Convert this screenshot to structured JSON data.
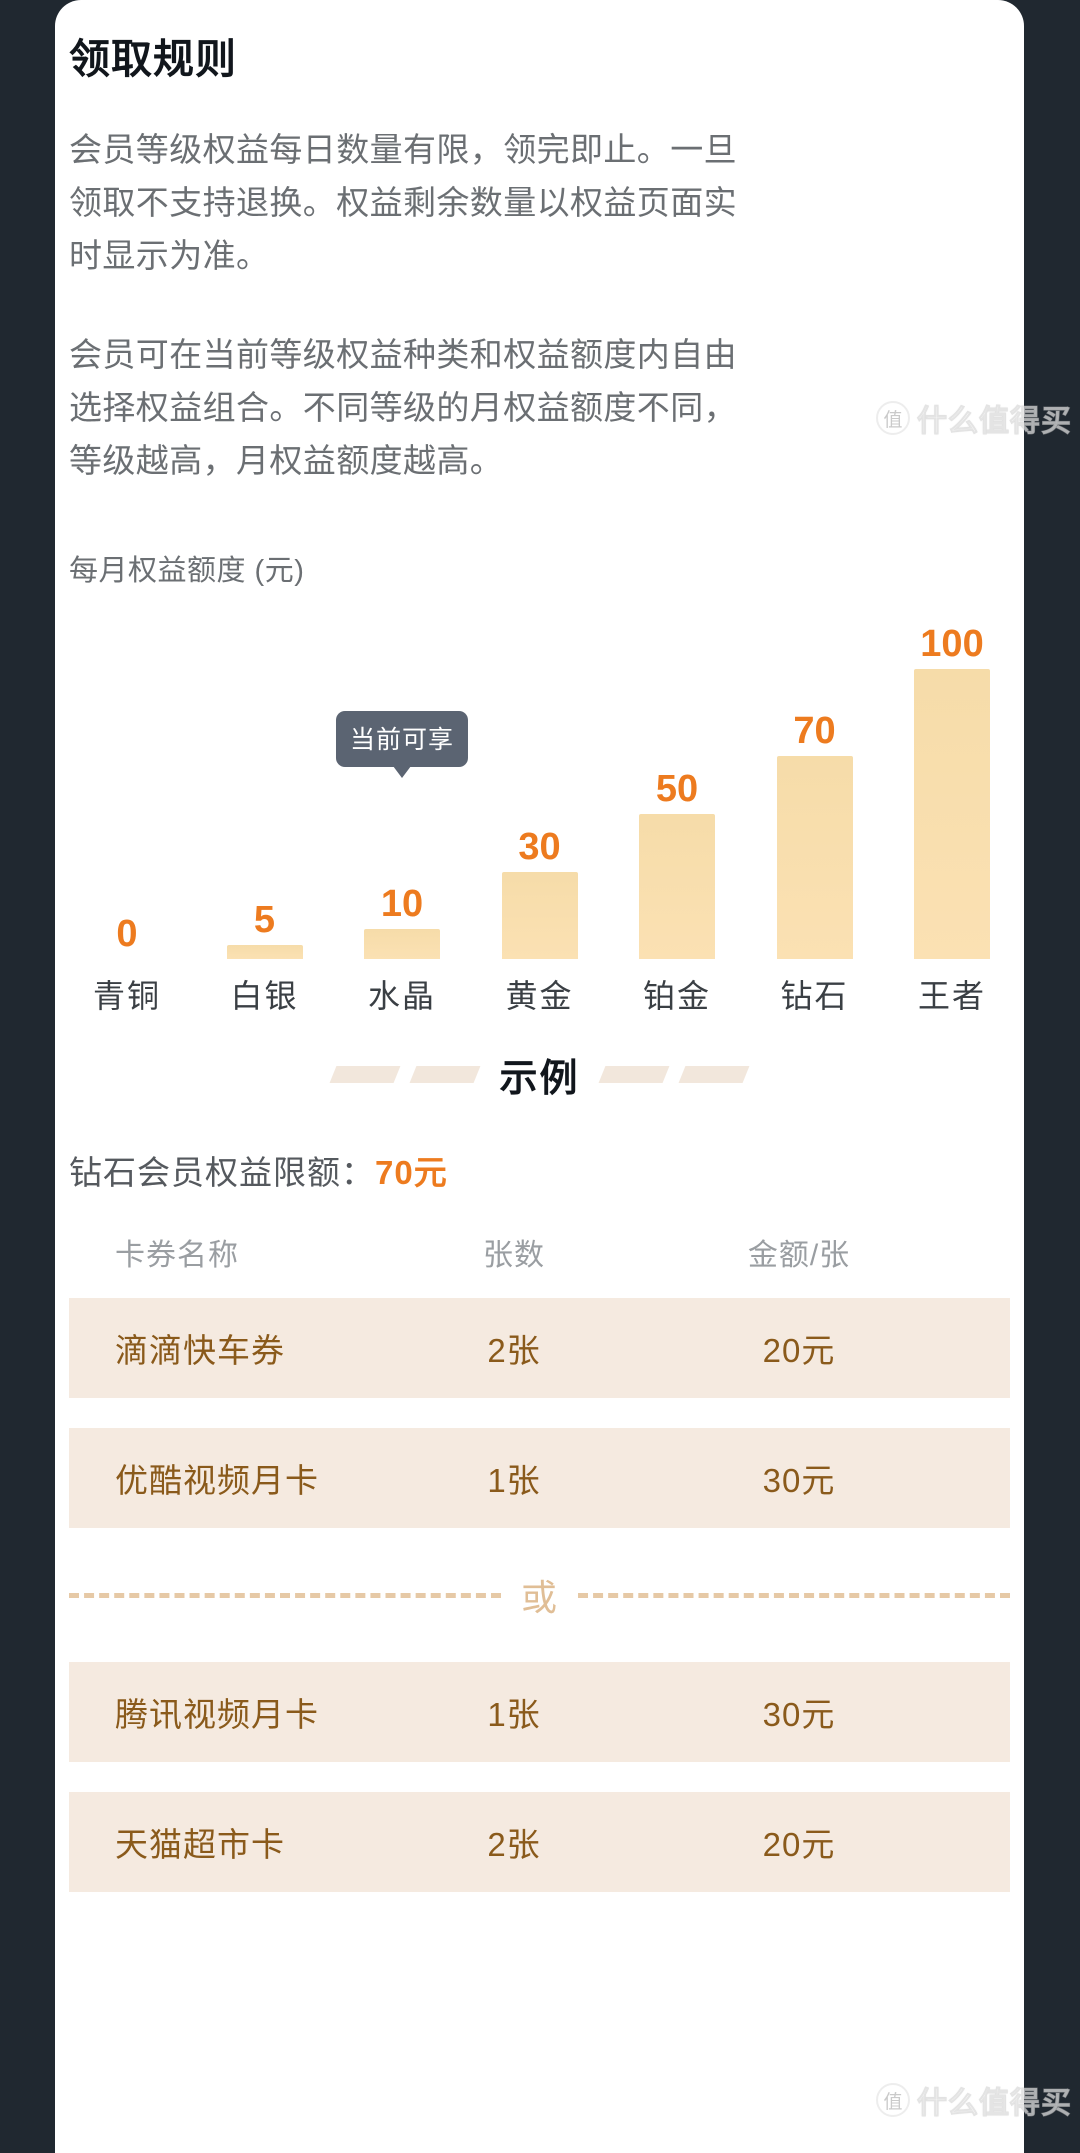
{
  "page": {
    "title": "领取规则",
    "background_color": "#202830",
    "card_color": "#ffffff",
    "accent_color": "#ED7B1F",
    "bar_color": "#F8DFAE",
    "row_color": "#F5EAE0",
    "row_text_color": "#8A5A1B"
  },
  "paragraphs": [
    "会员等级权益每日数量有限，领完即止。一旦领取不支持退换。权益剩余数量以权益页面实时显示为准。",
    "会员可在当前等级权益种类和权益额度内自由选择权益组合。不同等级的月权益额度不同，等级越高，月权益额度越高。"
  ],
  "chart_data": {
    "type": "bar",
    "title": "每月权益额度 (元)",
    "xlabel": "",
    "ylabel": "元",
    "ylim": [
      0,
      100
    ],
    "grid": false,
    "legend": false,
    "categories": [
      "青铜",
      "白银",
      "水晶",
      "黄金",
      "铂金",
      "钻石",
      "王者"
    ],
    "values": [
      0,
      5,
      10,
      30,
      50,
      70,
      100
    ],
    "value_labels": [
      "0",
      "5",
      "10",
      "30",
      "50",
      "70",
      "100"
    ],
    "annotations": [
      {
        "label": "当前可享",
        "category": "水晶",
        "index": 2
      }
    ]
  },
  "sample_section": {
    "divider_label": "示例",
    "limit_prefix": "钻石会员权益限额：",
    "limit_value": "70元"
  },
  "table": {
    "headers": [
      "卡券名称",
      "张数",
      "金额/张"
    ],
    "group_a": [
      {
        "name": "滴滴快车券",
        "count": "2张",
        "amount": "20元"
      },
      {
        "name": "优酷视频月卡",
        "count": "1张",
        "amount": "30元"
      }
    ],
    "or_label": "或",
    "group_b": [
      {
        "name": "腾讯视频月卡",
        "count": "1张",
        "amount": "30元"
      },
      {
        "name": "天猫超市卡",
        "count": "2张",
        "amount": "20元"
      }
    ]
  },
  "watermark": {
    "badge": "值",
    "text": "什么值得买"
  }
}
